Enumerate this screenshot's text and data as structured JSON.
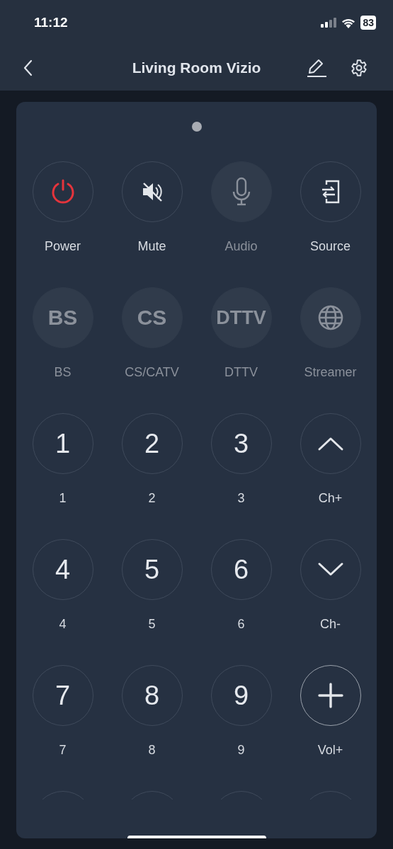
{
  "status_bar": {
    "time": "11:12",
    "battery": "83"
  },
  "nav": {
    "title": "Living Room Vizio"
  },
  "buttons": [
    {
      "kind": "power",
      "label": "Power",
      "disabled": false
    },
    {
      "kind": "mute",
      "label": "Mute",
      "disabled": false
    },
    {
      "kind": "mic",
      "label": "Audio",
      "disabled": true
    },
    {
      "kind": "source",
      "label": "Source",
      "disabled": false
    },
    {
      "kind": "text",
      "face": "BS",
      "label": "BS",
      "disabled": true
    },
    {
      "kind": "text",
      "face": "CS",
      "label": "CS/CATV",
      "disabled": true
    },
    {
      "kind": "text",
      "face": "DTTV",
      "label": "DTTV",
      "disabled": true
    },
    {
      "kind": "globe",
      "label": "Streamer",
      "disabled": true
    },
    {
      "kind": "text",
      "face": "1",
      "label": "1",
      "disabled": false
    },
    {
      "kind": "text",
      "face": "2",
      "label": "2",
      "disabled": false
    },
    {
      "kind": "text",
      "face": "3",
      "label": "3",
      "disabled": false
    },
    {
      "kind": "up",
      "label": "Ch+",
      "disabled": false
    },
    {
      "kind": "text",
      "face": "4",
      "label": "4",
      "disabled": false
    },
    {
      "kind": "text",
      "face": "5",
      "label": "5",
      "disabled": false
    },
    {
      "kind": "text",
      "face": "6",
      "label": "6",
      "disabled": false
    },
    {
      "kind": "down",
      "label": "Ch-",
      "disabled": false
    },
    {
      "kind": "text",
      "face": "7",
      "label": "7",
      "disabled": false
    },
    {
      "kind": "text",
      "face": "8",
      "label": "8",
      "disabled": false
    },
    {
      "kind": "text",
      "face": "9",
      "label": "9",
      "disabled": false
    },
    {
      "kind": "plus",
      "label": "Vol+",
      "disabled": false
    }
  ],
  "cut_off_buttons": [
    {
      "kind": "outline"
    },
    {
      "kind": "outline"
    },
    {
      "kind": "outline"
    },
    {
      "kind": "outline"
    }
  ]
}
